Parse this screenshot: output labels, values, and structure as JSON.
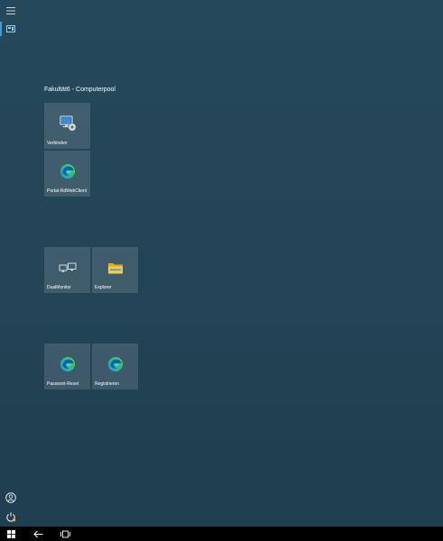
{
  "start_menu": {
    "group_title": "Fakultät6 - Computerpool",
    "tiles": [
      {
        "label": "Verbinden",
        "icon": "remote-desktop-icon"
      },
      {
        "label": "Portal-RdWebClient",
        "icon": "edge-icon"
      },
      {
        "label": "DualMonitor",
        "icon": "dual-monitor-icon"
      },
      {
        "label": "Explorer",
        "icon": "folder-icon"
      },
      {
        "label": "Passwort-Reset",
        "icon": "edge-icon"
      },
      {
        "label": "Registrieren",
        "icon": "edge-icon"
      }
    ]
  },
  "rail": {
    "items": [
      {
        "icon": "hamburger-menu-icon"
      },
      {
        "icon": "pinned-tiles-icon",
        "active": true
      },
      {
        "icon": "user-account-icon"
      },
      {
        "icon": "power-icon"
      }
    ]
  },
  "taskbar": {
    "items": [
      {
        "icon": "windows-start-icon"
      },
      {
        "icon": "back-arrow-icon"
      },
      {
        "icon": "task-view-icon"
      }
    ]
  },
  "colors": {
    "background": "#24465a",
    "tile": "#3e5d6e",
    "accent": "#3a9be6",
    "taskbar": "#000000"
  }
}
